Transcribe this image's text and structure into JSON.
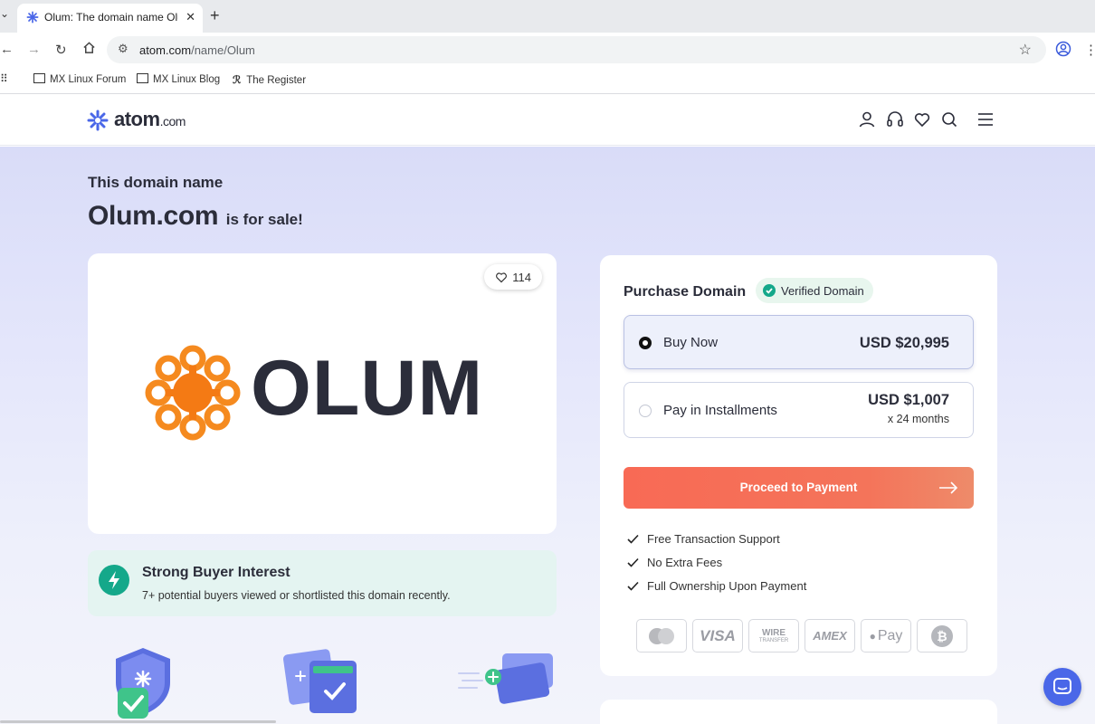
{
  "browser": {
    "tab_title": "Olum: The domain name Olum.com is for sale",
    "url_host": "atom.com",
    "url_path": "/name/Olum",
    "bookmarks": [
      "MX Linux Forum",
      "MX Linux Blog",
      "The Register"
    ]
  },
  "site": {
    "logo_text": "atom",
    "logo_tld": ".com"
  },
  "hero": {
    "kicker": "This domain name",
    "domain": "Olum.com",
    "for_sale": "is for sale!"
  },
  "logo_card": {
    "likes": "114",
    "brand_word": "OLUM"
  },
  "interest": {
    "heading": "Strong Buyer Interest",
    "text": "7+ potential buyers viewed or shortlisted this domain recently."
  },
  "purchase": {
    "title": "Purchase Domain",
    "verified": "Verified Domain",
    "options": [
      {
        "label": "Buy Now",
        "price": "USD $20,995",
        "selected": true
      },
      {
        "label": "Pay in Installments",
        "price": "USD $1,007",
        "sub": "x 24 months",
        "selected": false
      }
    ],
    "cta": "Proceed to Payment",
    "features": [
      "Free Transaction Support",
      "No Extra Fees",
      "Full Ownership Upon Payment"
    ],
    "payment_methods": [
      "mastercard-icon",
      "visa-icon",
      "wire-transfer-icon",
      "amex-icon",
      "apple-pay-icon",
      "bitcoin-icon"
    ],
    "pay_labels": {
      "visa": "VISA",
      "wire": "WIRE",
      "transfer": "TRANSFER",
      "amex": "AMEX",
      "applepay": "Pay"
    }
  },
  "colors": {
    "accent": "#f86a55",
    "brand_blue": "#4a67e8",
    "verified_green": "#14a88a",
    "olum_orange": "#f58a1f"
  }
}
